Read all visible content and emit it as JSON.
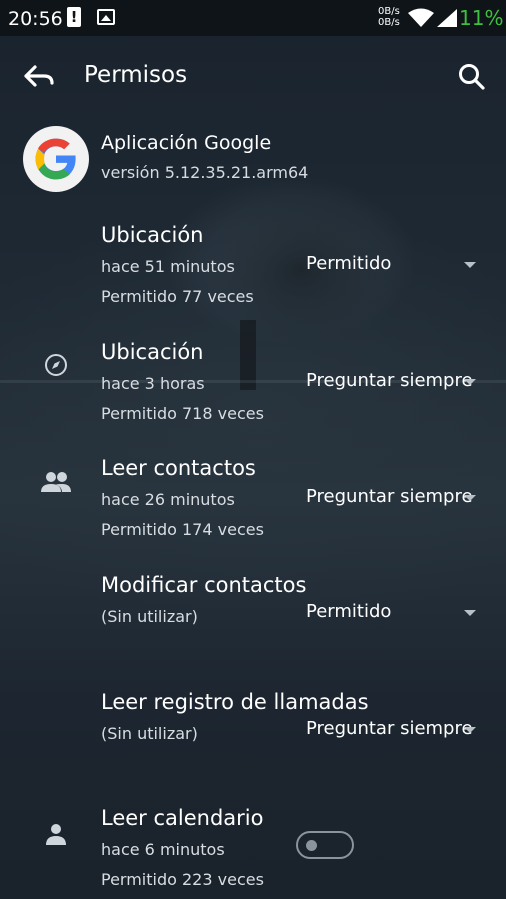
{
  "status_bar": {
    "time": "20:56",
    "alert_icon": "alert-icon",
    "image_icon": "image-icon",
    "speed_up": "0B/s",
    "speed_down": "0B/s",
    "wifi_icon": "wifi-icon",
    "signal_icon": "signal-icon",
    "battery": "11%",
    "battery_color": "#3fbf3f"
  },
  "toolbar": {
    "back_icon": "back-arrow-icon",
    "title": "Permisos",
    "search_icon": "search-icon"
  },
  "app": {
    "logo_icon": "google-logo-icon",
    "name": "Aplicación Google",
    "version": "versión 5.12.35.21.arm64"
  },
  "permissions": [
    {
      "title": "Ubicación",
      "line1": "hace 51 minutos",
      "line2": "Permitido 77 veces",
      "icon": "",
      "control": "dropdown",
      "value": "Permitido"
    },
    {
      "title": "Ubicación",
      "line1": "hace 3 horas",
      "line2": "Permitido 718 veces",
      "icon": "compass-icon",
      "control": "dropdown",
      "value": "Preguntar siempre"
    },
    {
      "title": "Leer contactos",
      "line1": "hace 26 minutos",
      "line2": "Permitido 174 veces",
      "icon": "contacts-icon",
      "control": "dropdown",
      "value": "Preguntar siempre"
    },
    {
      "title": "Modificar contactos",
      "line1": "(Sin utilizar)",
      "line2": "",
      "icon": "",
      "control": "dropdown",
      "value": "Permitido"
    },
    {
      "title": "Leer registro de llamadas",
      "line1": "(Sin utilizar)",
      "line2": "",
      "icon": "",
      "control": "dropdown",
      "value": "Preguntar siempre"
    },
    {
      "title": "Leer calendario",
      "line1": "hace 6 minutos",
      "line2": "Permitido 223 veces",
      "icon": "person-icon",
      "control": "toggle",
      "toggle_on": false
    }
  ]
}
